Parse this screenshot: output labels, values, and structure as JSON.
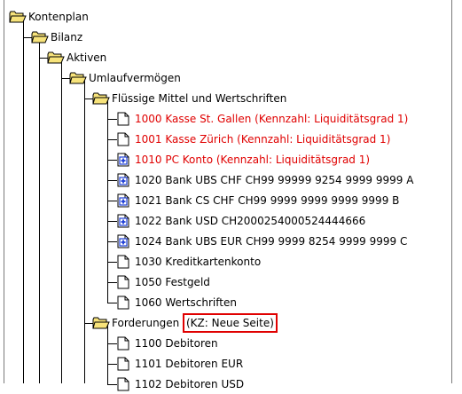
{
  "tree": {
    "items": [
      {
        "level": 0,
        "icon": "folder-icon",
        "label": "Kontenplan"
      },
      {
        "level": 1,
        "icon": "folder-icon",
        "label": "Bilanz"
      },
      {
        "level": 2,
        "icon": "folder-icon",
        "label": "Aktiven"
      },
      {
        "level": 3,
        "icon": "folder-icon",
        "label": "Umlaufvermögen"
      },
      {
        "level": 4,
        "icon": "folder-icon",
        "label": "Flüssige Mittel und Wertschriften"
      },
      {
        "level": 5,
        "icon": "document-icon",
        "label": "1000 Kasse St. Gallen (Kennzahl: Liquiditätsgrad 1)",
        "color": "#e00000"
      },
      {
        "level": 5,
        "icon": "document-icon",
        "label": "1001 Kasse Zürich (Kennzahl: Liquiditätsgrad 1)",
        "color": "#e00000"
      },
      {
        "level": 5,
        "icon": "bank-plus-icon",
        "label": "1010 PC Konto (Kennzahl: Liquiditätsgrad 1)",
        "color": "#e00000"
      },
      {
        "level": 5,
        "icon": "bank-plus-icon",
        "label": "1020 Bank UBS CHF CH99 99999 9254 9999 9999 A"
      },
      {
        "level": 5,
        "icon": "bank-plus-icon",
        "label": "1021 Bank CS CHF CH99 9999 9999 9999 9999 B"
      },
      {
        "level": 5,
        "icon": "bank-plus-icon",
        "label": "1022 Bank USD CH2000254000524444666"
      },
      {
        "level": 5,
        "icon": "bank-plus-icon",
        "label": "1024 Bank UBS EUR CH99 9999  8254 9999 9999 C"
      },
      {
        "level": 5,
        "icon": "document-icon",
        "label": "1030 Kreditkartenkonto"
      },
      {
        "level": 5,
        "icon": "document-icon",
        "label": "1050 Festgeld"
      },
      {
        "level": 5,
        "icon": "document-icon",
        "label": "1060 Wertschriften"
      },
      {
        "level": 4,
        "icon": "folder-icon",
        "label": "Forderungen",
        "annotation": "(KZ: Neue Seite)"
      },
      {
        "level": 5,
        "icon": "document-icon",
        "label": "1100 Debitoren"
      },
      {
        "level": 5,
        "icon": "document-icon",
        "label": "1101 Debitoren EUR"
      },
      {
        "level": 5,
        "icon": "document-icon",
        "label": "1102 Debitoren USD"
      }
    ]
  },
  "colors": {
    "highlight_text": "#e00000",
    "annotation_border": "#e00000",
    "folder_fill": "#f7e37a",
    "bank_icon_blue": "#1f3fd6"
  }
}
